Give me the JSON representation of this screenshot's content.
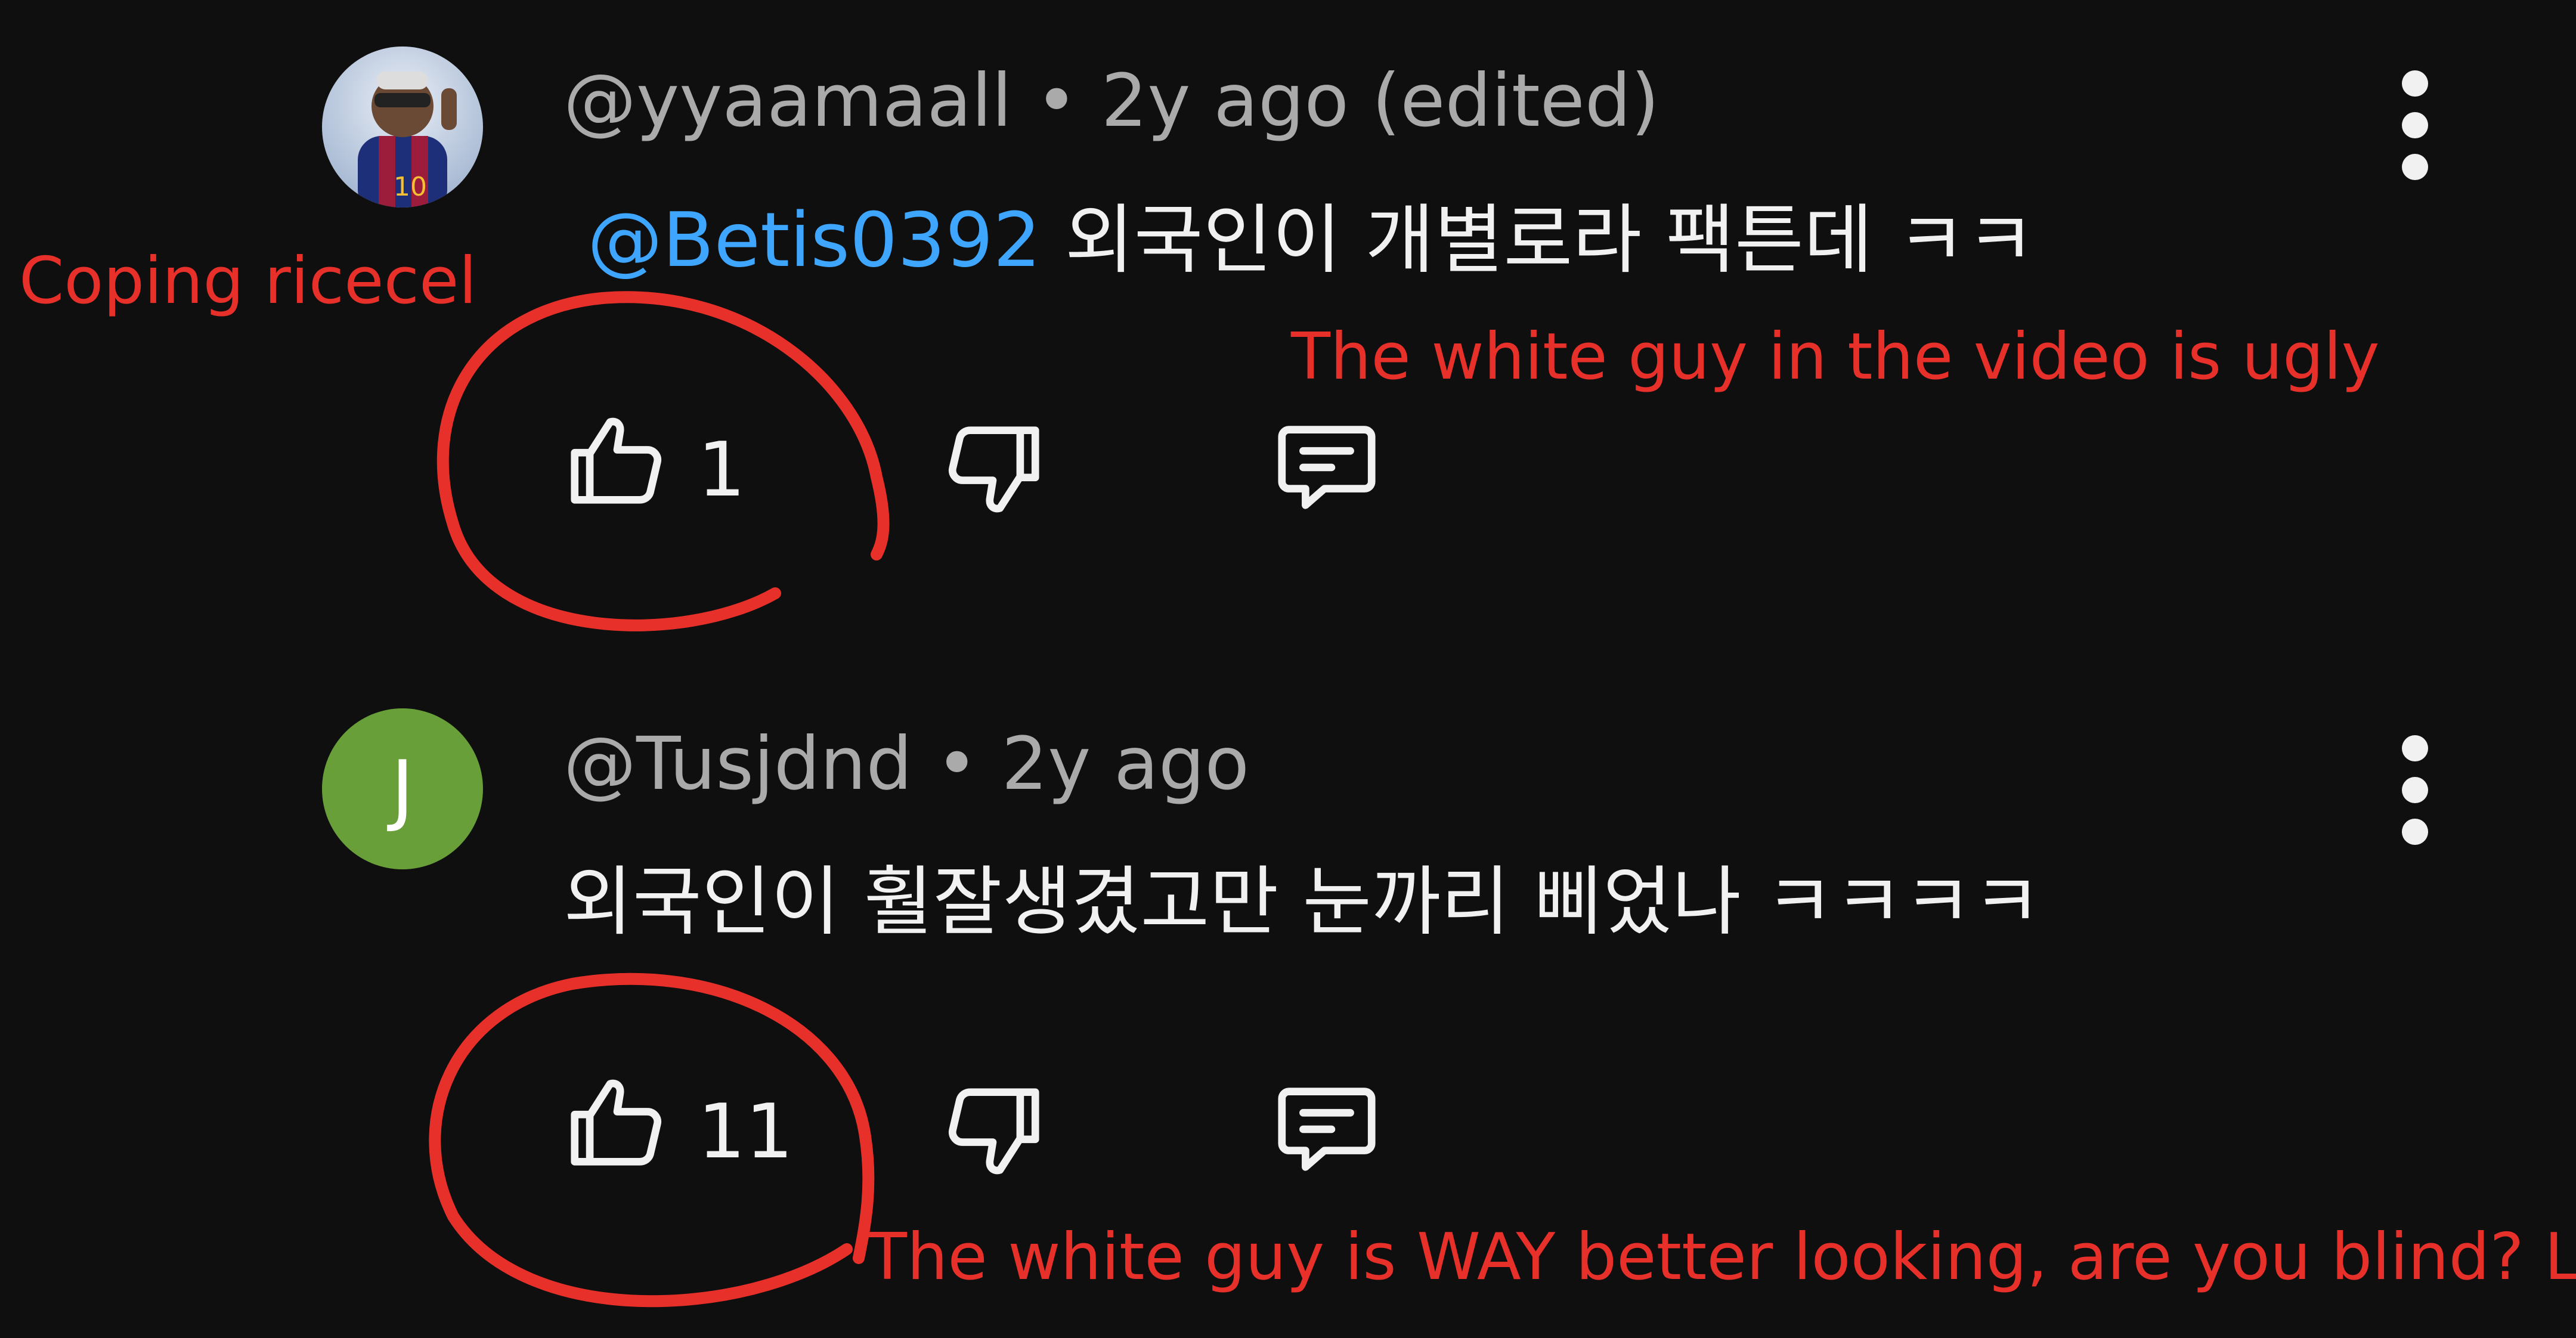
{
  "comments": [
    {
      "handle": "@yyaamaall",
      "separator": "•",
      "time": "2y ago (edited)",
      "mention": "@Betis0392",
      "text": "외국인이 개별로라 팩튼데 ㅋㅋ",
      "likes": "1",
      "avatar": "photo"
    },
    {
      "handle": "@Tusjdnd",
      "separator": "•",
      "time": "2y ago",
      "text": "외국인이 훨잘생겼고만 눈까리 삐었나 ㅋㅋㅋㅋ",
      "likes": "11",
      "avatar_letter": "J",
      "avatar_color": "#689f38"
    }
  ],
  "annotations": {
    "left_label": "Coping ricecel",
    "first_reply_note": "The white guy in the video is ugly",
    "second_reply_note": "The white guy is WAY better looking, are you blind? LOL"
  },
  "colors": {
    "background": "#0f0f0f",
    "mention": "#3ea6ff",
    "annotation": "#e8302a",
    "meta": "#aaaaaa",
    "text": "#f1f1f1"
  },
  "icons": [
    "thumbs-up-icon",
    "thumbs-down-icon",
    "reply-icon",
    "more-vert-icon"
  ]
}
